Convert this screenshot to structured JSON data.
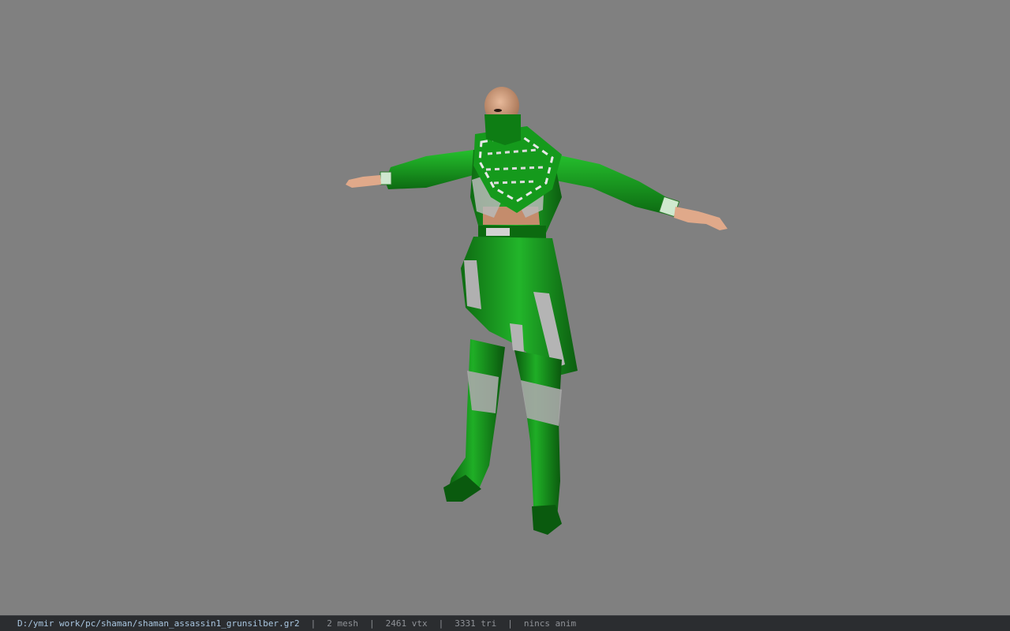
{
  "viewport": {
    "background": "#808080",
    "model": "character-mesh"
  },
  "statusbar": {
    "file_path": "D:/ymir work/pc/shaman/shaman_assassin1_grunsilber.gr2",
    "separator": "|",
    "mesh_count": "2 mesh",
    "vertex_count": "2461 vtx",
    "triangle_count": "3331 tri",
    "anim": "nincs anim",
    "path_color": "#a9c6e0",
    "stat_color": "#8f9297"
  }
}
